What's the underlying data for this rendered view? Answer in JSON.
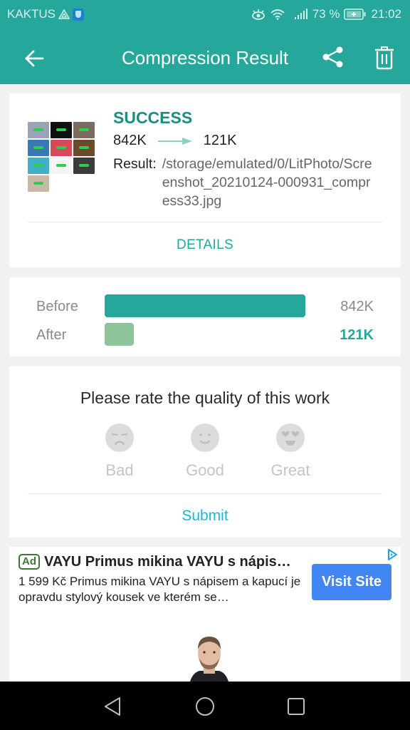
{
  "status_bar": {
    "carrier": "KAKTUS",
    "battery_percent": "73 %",
    "time": "21:02",
    "icons": [
      "carrier-triangle-icon",
      "shield-app-icon",
      "eye-comfort-icon",
      "wifi-icon",
      "signal-icon",
      "battery-charging-icon"
    ]
  },
  "app_bar": {
    "title": "Compression Result",
    "back_icon": "arrow-left-icon",
    "share_icon": "share-icon",
    "delete_icon": "trash-icon"
  },
  "result_card": {
    "status": "SUCCESS",
    "size_before": "842K",
    "size_after": "121K",
    "result_label": "Result:",
    "result_path": "/storage/emulated/0/LitPhoto/Screenshot_20210124-000931_compress33.jpg",
    "details_label": "DETAILS",
    "thumbnail_colors": [
      "#9aa3b8",
      "#101010",
      "#7b6a60",
      "#3a78b5",
      "#d9475a",
      "#6a4a2a",
      "#3fb0c8",
      "#f4f4f4",
      "#3b3b3b",
      "#c9b7a8"
    ]
  },
  "comparison": {
    "rows": [
      {
        "label": "Before",
        "value": "842K",
        "fraction": 1.0,
        "color": "#25a79b"
      },
      {
        "label": "After",
        "value": "121K",
        "fraction": 0.1437,
        "color": "#8fc49a"
      }
    ]
  },
  "rating_card": {
    "title": "Please rate the quality of this work",
    "options": [
      {
        "label": "Bad",
        "icon": "sad-face-icon"
      },
      {
        "label": "Good",
        "icon": "smile-face-icon"
      },
      {
        "label": "Great",
        "icon": "heart-eyes-face-icon"
      }
    ],
    "submit_label": "Submit"
  },
  "ad": {
    "badge": "Ad",
    "title": "VAYU Primus mikina VAYU s nápis…",
    "description": "1 599 Kč Primus mikina VAYU s nápisem a kapucí je opravdu stylový kousek ve kterém se…",
    "cta_label": "Visit Site",
    "image": "man-in-black-hoodie-photo"
  },
  "nav_bar": {
    "buttons": [
      "back-triangle-icon",
      "home-circle-icon",
      "recents-square-icon"
    ]
  },
  "colors": {
    "accent": "#25a79b",
    "success_text": "#1e8c82",
    "submit": "#1ab8d2",
    "cta": "#4285f4"
  }
}
